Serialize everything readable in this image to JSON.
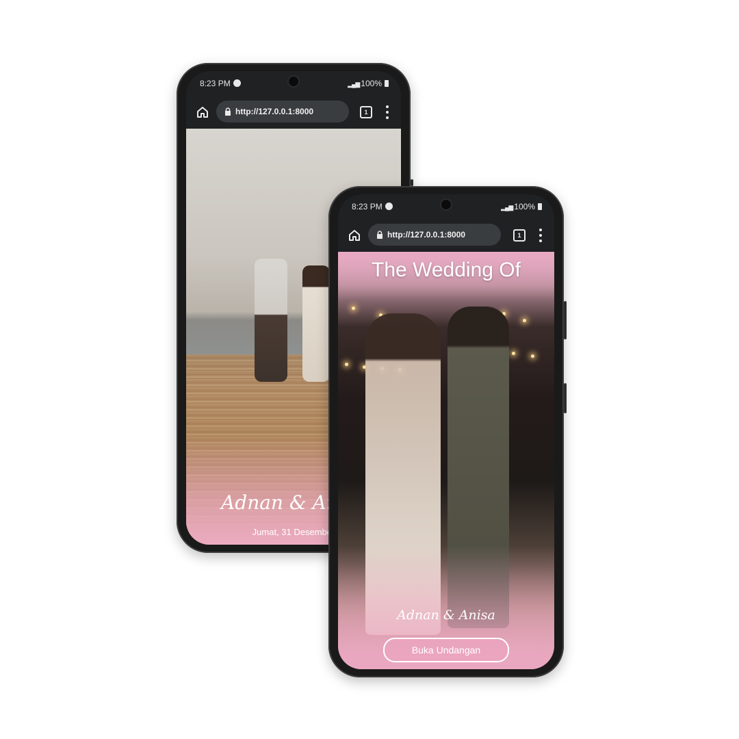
{
  "browser": {
    "time": "8:23 PM",
    "battery": "100%",
    "url": "http://127.0.0.1:8000",
    "tab_count": "1"
  },
  "back_phone": {
    "couple_names": "Adnan & Anisa",
    "date": "Jumat, 31 Desember"
  },
  "front_phone": {
    "title": "The Wedding Of",
    "couple_names": "Adnan & Anisa",
    "open_button": "Buka Undangan"
  },
  "colors": {
    "accent_pink": "#ecabc1",
    "chrome_dark": "#1f2123",
    "omnibox": "#3a3d40"
  },
  "icons": [
    "home-icon",
    "lock-icon",
    "tabs-icon",
    "overflow-menu-icon",
    "spotify-icon",
    "signal-icon",
    "battery-icon"
  ]
}
